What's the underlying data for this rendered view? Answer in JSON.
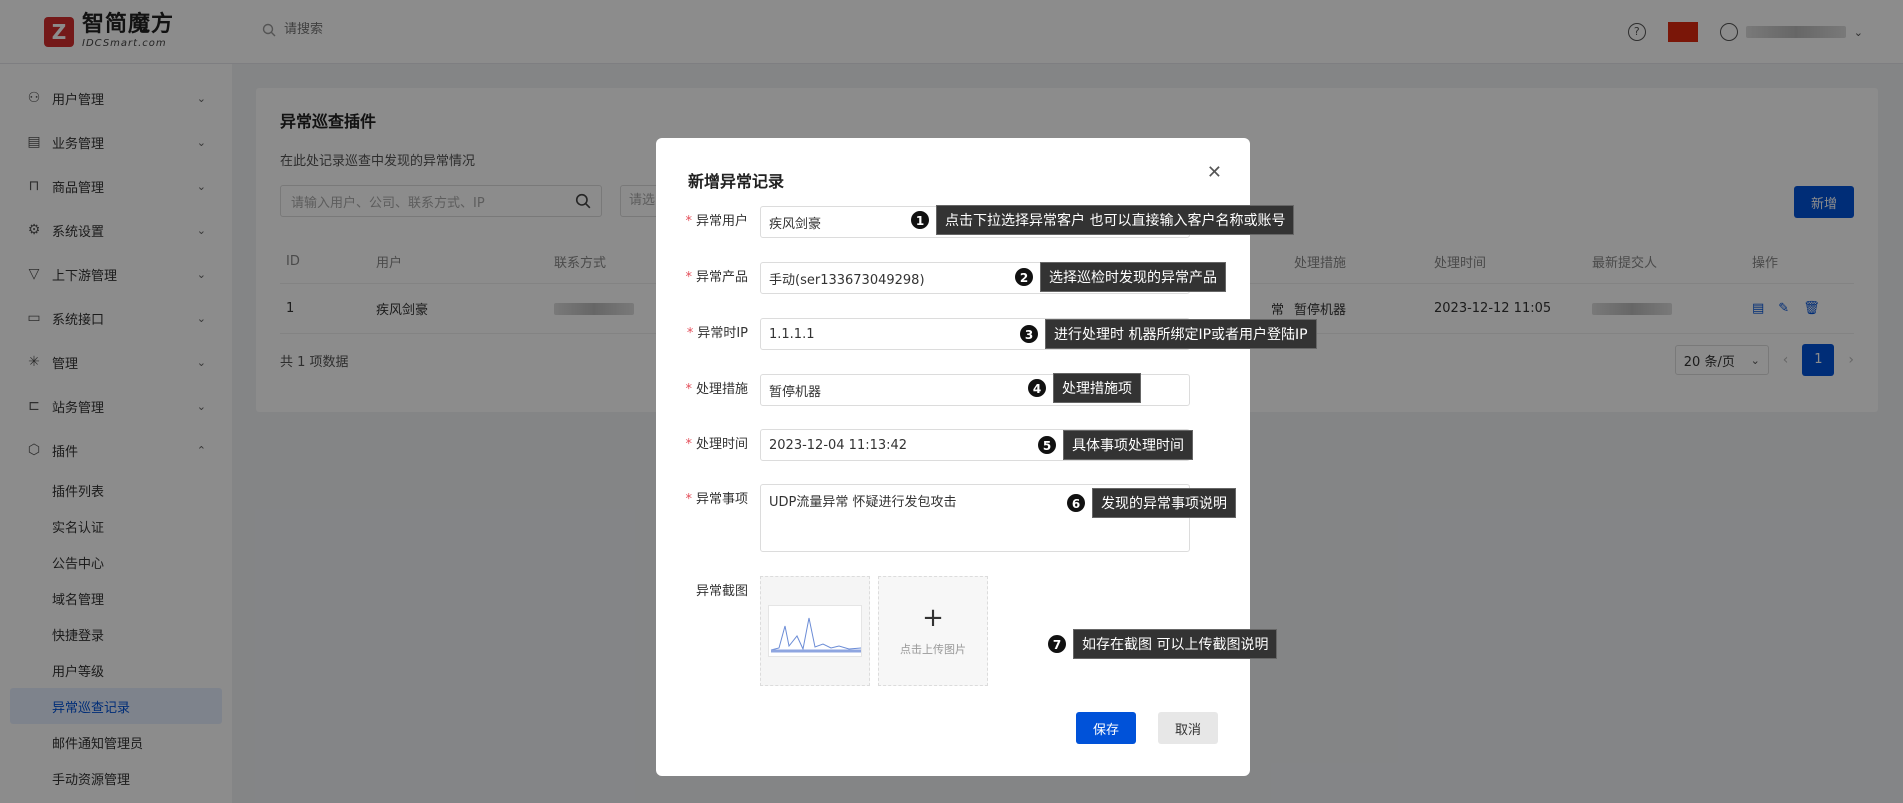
{
  "header": {
    "logo_cn": "智简魔方",
    "logo_en": "IDCSmart.com",
    "search_placeholder": "请搜索"
  },
  "sidebar": {
    "items": [
      {
        "label": "用户管理",
        "icon": "user-icon"
      },
      {
        "label": "业务管理",
        "icon": "document-icon"
      },
      {
        "label": "商品管理",
        "icon": "cart-icon"
      },
      {
        "label": "系统设置",
        "icon": "gear-icon"
      },
      {
        "label": "上下游管理",
        "icon": "filter-icon"
      },
      {
        "label": "系统接口",
        "icon": "folder-icon"
      },
      {
        "label": "管理",
        "icon": "asterisk-icon"
      },
      {
        "label": "站务管理",
        "icon": "share-icon"
      },
      {
        "label": "插件",
        "icon": "cube-icon"
      }
    ],
    "sub_items": [
      "插件列表",
      "实名认证",
      "公告中心",
      "域名管理",
      "快捷登录",
      "用户等级",
      "异常巡查记录",
      "邮件通知管理员",
      "手动资源管理"
    ]
  },
  "page": {
    "title": "异常巡查插件",
    "description": "在此处记录巡查中发现的异常情况",
    "filter_placeholder": "请输入用户、公司、联系方式、IP",
    "filter2_placeholder": "请选",
    "add_label": "新增",
    "table": {
      "headers": {
        "id": "ID",
        "user": "用户",
        "contact": "联系方式",
        "measure": "处理措施",
        "time": "处理时间",
        "submitter": "最新提交人",
        "op": "操作"
      },
      "row": {
        "id": "1",
        "user": "疾风剑豪",
        "status_fragment": "常",
        "measure": "暂停机器",
        "time": "2023-12-12 11:05"
      }
    },
    "total": "共 1 项数据",
    "page_size": "20 条/页",
    "current_page": "1"
  },
  "modal": {
    "title": "新增异常记录",
    "fields": {
      "user": {
        "label": "异常用户",
        "value": "疾风剑豪"
      },
      "product": {
        "label": "异常产品",
        "value": "手动(ser133673049298)"
      },
      "ip": {
        "label": "异常时IP",
        "value": "1.1.1.1"
      },
      "measure": {
        "label": "处理措施",
        "value": "暂停机器"
      },
      "time": {
        "label": "处理时间",
        "value": "2023-12-04 11:13:42"
      },
      "issue": {
        "label": "异常事项",
        "value": "UDP流量异常 怀疑进行发包攻击"
      },
      "screenshot": {
        "label": "异常截图",
        "upload_text": "点击上传图片"
      }
    },
    "save_label": "保存",
    "cancel_label": "取消"
  },
  "callouts": [
    {
      "num": "1",
      "text": "点击下拉选择异常客户 也可以直接输入客户名称或账号"
    },
    {
      "num": "2",
      "text": "选择巡检时发现的异常产品"
    },
    {
      "num": "3",
      "text": "进行处理时 机器所绑定IP或者用户登陆IP"
    },
    {
      "num": "4",
      "text": "处理措施项"
    },
    {
      "num": "5",
      "text": "具体事项处理时间"
    },
    {
      "num": "6",
      "text": "发现的异常事项说明"
    },
    {
      "num": "7",
      "text": "如存在截图 可以上传截图说明"
    }
  ],
  "colors": {
    "primary": "#0052d9",
    "brand_red": "#d32f2f",
    "required": "#e34d59"
  }
}
